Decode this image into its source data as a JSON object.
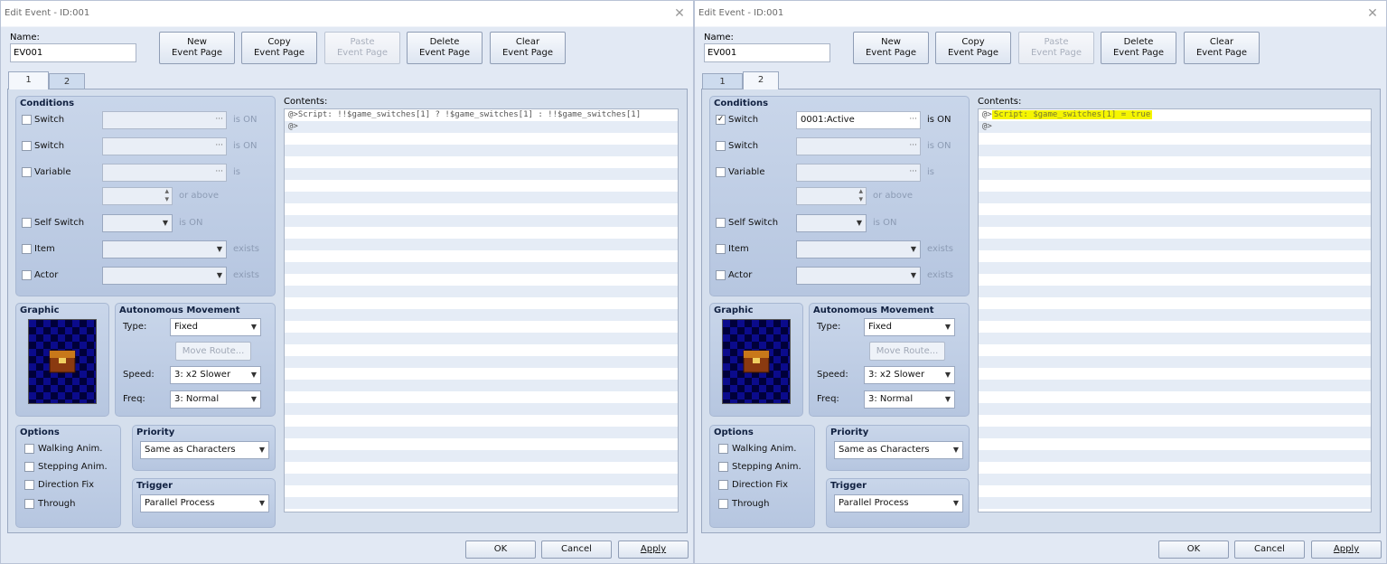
{
  "windows": [
    {
      "title": "Edit Event - ID:001",
      "name_label": "Name:",
      "name_value": "EV001",
      "toolbar": {
        "new": "New\nEvent Page",
        "copy": "Copy\nEvent Page",
        "paste": "Paste\nEvent Page",
        "delete": "Delete\nEvent Page",
        "clear": "Clear\nEvent Page"
      },
      "tabs": [
        "1",
        "2"
      ],
      "active_tab": "1",
      "conditions": {
        "title": "Conditions",
        "switch1_label": "Switch",
        "switch1_checked": false,
        "switch1_value": "",
        "switch1_suffix": "is ON",
        "switch2_label": "Switch",
        "switch2_value": "",
        "switch2_suffix": "is ON",
        "variable_label": "Variable",
        "variable_value": "",
        "variable_suffix": "is",
        "or_above": "or above",
        "self_switch_label": "Self Switch",
        "self_switch_suffix": "is ON",
        "item_label": "Item",
        "item_suffix": "exists",
        "actor_label": "Actor",
        "actor_suffix": "exists"
      },
      "graphic_title": "Graphic",
      "movement": {
        "title": "Autonomous Movement",
        "type_label": "Type:",
        "type_value": "Fixed",
        "move_route": "Move Route...",
        "speed_label": "Speed:",
        "speed_value": "3: x2 Slower",
        "freq_label": "Freq:",
        "freq_value": "3: Normal"
      },
      "options": {
        "title": "Options",
        "walking": "Walking Anim.",
        "stepping": "Stepping Anim.",
        "direction": "Direction Fix",
        "through": "Through"
      },
      "priority": {
        "title": "Priority",
        "value": "Same as Characters"
      },
      "trigger": {
        "title": "Trigger",
        "value": "Parallel Process"
      },
      "contents_label": "Contents:",
      "contents": {
        "line1_prefix": "@>",
        "line1_text": "Script: !!$game_switches[1] ? !$game_switches[1] : !!$game_switches[1]",
        "line2": "@>"
      },
      "buttons": {
        "ok": "OK",
        "cancel": "Cancel",
        "apply": "Apply"
      }
    },
    {
      "title": "Edit Event - ID:001",
      "name_label": "Name:",
      "name_value": "EV001",
      "toolbar": {
        "new": "New\nEvent Page",
        "copy": "Copy\nEvent Page",
        "paste": "Paste\nEvent Page",
        "delete": "Delete\nEvent Page",
        "clear": "Clear\nEvent Page"
      },
      "tabs": [
        "1",
        "2"
      ],
      "active_tab": "2",
      "conditions": {
        "title": "Conditions",
        "switch1_label": "Switch",
        "switch1_checked": true,
        "switch1_value": "0001:Active",
        "switch1_suffix": "is ON",
        "switch2_label": "Switch",
        "switch2_value": "",
        "switch2_suffix": "is ON",
        "variable_label": "Variable",
        "variable_value": "",
        "variable_suffix": "is",
        "or_above": "or above",
        "self_switch_label": "Self Switch",
        "self_switch_suffix": "is ON",
        "item_label": "Item",
        "item_suffix": "exists",
        "actor_label": "Actor",
        "actor_suffix": "exists"
      },
      "graphic_title": "Graphic",
      "movement": {
        "title": "Autonomous Movement",
        "type_label": "Type:",
        "type_value": "Fixed",
        "move_route": "Move Route...",
        "speed_label": "Speed:",
        "speed_value": "3: x2 Slower",
        "freq_label": "Freq:",
        "freq_value": "3: Normal"
      },
      "options": {
        "title": "Options",
        "walking": "Walking Anim.",
        "stepping": "Stepping Anim.",
        "direction": "Direction Fix",
        "through": "Through"
      },
      "priority": {
        "title": "Priority",
        "value": "Same as Characters"
      },
      "trigger": {
        "title": "Trigger",
        "value": "Parallel Process"
      },
      "contents_label": "Contents:",
      "contents": {
        "line1_prefix": "@>",
        "line1_text": "Script: $game_switches[1] = true",
        "line2": "@>"
      },
      "buttons": {
        "ok": "OK",
        "cancel": "Cancel",
        "apply": "Apply"
      }
    }
  ],
  "colors": {
    "highlight": "#f5f500",
    "group_blue": "#b6c6e0",
    "graphic_bg": "#000050"
  },
  "icons": {
    "close": "close-icon",
    "ellipsis": "ellipsis-icon",
    "dropdown": "chevron-down-icon",
    "check": "check-icon"
  }
}
